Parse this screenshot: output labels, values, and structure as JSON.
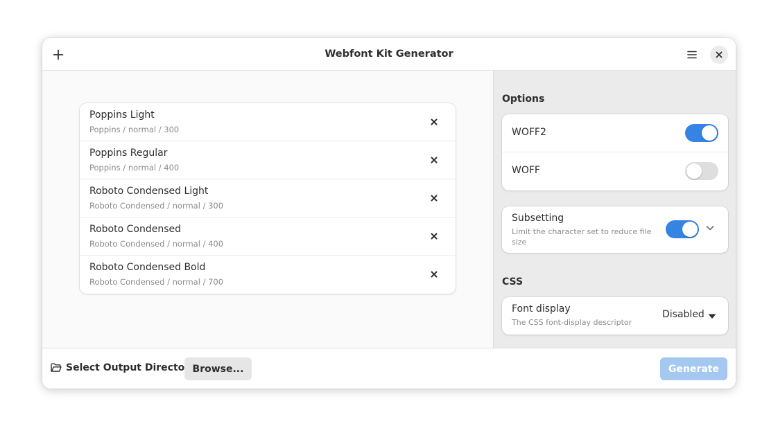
{
  "window": {
    "title": "Webfont Kit Generator"
  },
  "icons": {
    "add": "plus-icon",
    "menu": "hamburger-menu-icon",
    "close": "close-icon",
    "remove": "remove-x-icon",
    "expand": "chevron-down-icon",
    "dropdown": "triangle-down-icon",
    "folder": "folder-open-icon"
  },
  "fonts": [
    {
      "name": "Poppins Light",
      "detail": "Poppins / normal / 300"
    },
    {
      "name": "Poppins Regular",
      "detail": "Poppins / normal / 400"
    },
    {
      "name": "Roboto Condensed Light",
      "detail": "Roboto Condensed / normal / 300"
    },
    {
      "name": "Roboto Condensed",
      "detail": "Roboto Condensed / normal / 400"
    },
    {
      "name": "Roboto Condensed Bold",
      "detail": "Roboto Condensed / normal / 700"
    }
  ],
  "options": {
    "section_title": "Options",
    "woff2": {
      "label": "WOFF2",
      "enabled": true
    },
    "woff": {
      "label": "WOFF",
      "enabled": false
    },
    "subsetting": {
      "title": "Subsetting",
      "description": "Limit the character set to reduce file size",
      "enabled": true
    }
  },
  "css": {
    "section_title": "CSS",
    "font_display": {
      "title": "Font display",
      "description": "The CSS font-display descriptor",
      "value": "Disabled"
    }
  },
  "bottom": {
    "output_label": "Select Output Directory",
    "browse_label": "Browse...",
    "generate_label": "Generate",
    "generate_enabled": false
  },
  "colors": {
    "accent": "#3584e4",
    "accent_disabled": "#a4c8f0",
    "switch_off": "#dedede"
  }
}
